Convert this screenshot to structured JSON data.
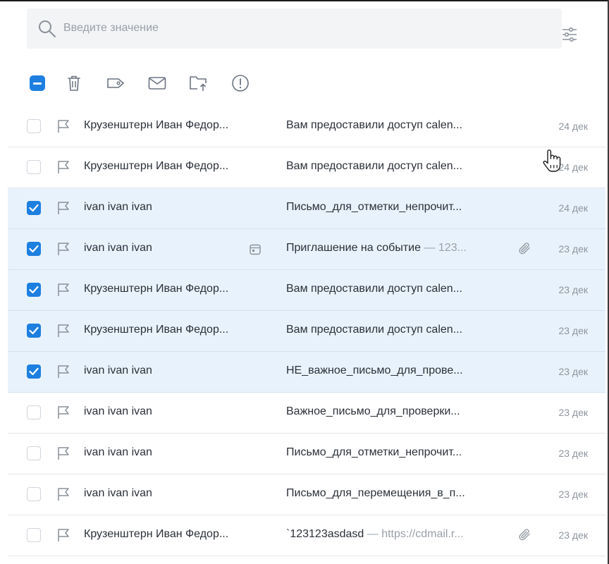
{
  "search": {
    "value": "",
    "placeholder": "Введите значение"
  },
  "toolbar": {
    "icons": [
      "select-all-checkbox",
      "trash-icon",
      "tag-icon",
      "envelope-icon",
      "move-folder-icon",
      "important-icon"
    ]
  },
  "colors": {
    "accent": "#1d7fe0",
    "selected_row": "#e8f2fc",
    "muted_text": "#9aa0a8"
  },
  "emails": [
    {
      "selected": false,
      "sender": "Крузенштерн Иван Федор...",
      "subject": "Вам предоставили доступ calen...",
      "snippet": "",
      "calendar": false,
      "attachment": false,
      "date": "24 дек"
    },
    {
      "selected": false,
      "sender": "Крузенштерн Иван Федор...",
      "subject": "Вам предоставили доступ calen...",
      "snippet": "",
      "calendar": false,
      "attachment": false,
      "date": "24 дек"
    },
    {
      "selected": true,
      "sender": "ivan ivan ivan",
      "subject": "Письмо_для_отметки_непрочит...",
      "snippet": "",
      "calendar": false,
      "attachment": false,
      "date": "24 дек"
    },
    {
      "selected": true,
      "sender": "ivan ivan ivan",
      "subject": "Приглашение на событие",
      "snippet": " — 123...",
      "calendar": true,
      "attachment": true,
      "date": "23 дек"
    },
    {
      "selected": true,
      "sender": "Крузенштерн Иван Федор...",
      "subject": "Вам предоставили доступ calen...",
      "snippet": "",
      "calendar": false,
      "attachment": false,
      "date": "23 дек"
    },
    {
      "selected": true,
      "sender": "Крузенштерн Иван Федор...",
      "subject": "Вам предоставили доступ calen...",
      "snippet": "",
      "calendar": false,
      "attachment": false,
      "date": "23 дек"
    },
    {
      "selected": true,
      "sender": "ivan ivan ivan",
      "subject": "НЕ_важное_письмо_для_прове...",
      "snippet": "",
      "calendar": false,
      "attachment": false,
      "date": "23 дек"
    },
    {
      "selected": false,
      "sender": "ivan ivan ivan",
      "subject": "Важное_письмо_для_проверки...",
      "snippet": "",
      "calendar": false,
      "attachment": false,
      "date": "23 дек"
    },
    {
      "selected": false,
      "sender": "ivan ivan ivan",
      "subject": "Письмо_для_отметки_непрочит...",
      "snippet": "",
      "calendar": false,
      "attachment": false,
      "date": "23 дек"
    },
    {
      "selected": false,
      "sender": "ivan ivan ivan",
      "subject": "Письмо_для_перемещения_в_п...",
      "snippet": "",
      "calendar": false,
      "attachment": false,
      "date": "23 дек"
    },
    {
      "selected": false,
      "sender": "Крузенштерн Иван Федор...",
      "subject": "`123123asdasd",
      "snippet": " — https://cdmail.r...",
      "calendar": false,
      "attachment": true,
      "date": "23 дек"
    }
  ]
}
